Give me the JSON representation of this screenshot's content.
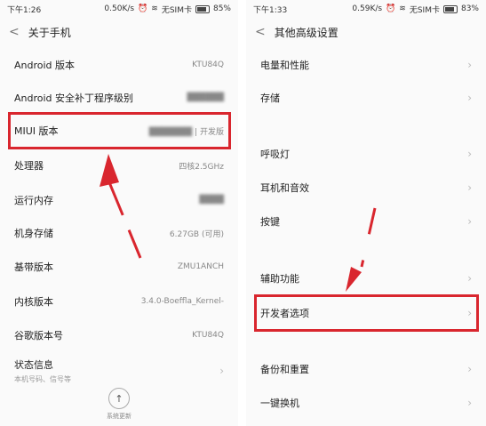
{
  "left": {
    "status": {
      "time": "下午1:26",
      "speed": "0.50K/s",
      "sim": "无SIM卡",
      "battery": "85%",
      "battery_level": 0.85
    },
    "title": "关于手机",
    "rows": [
      {
        "label": "Android 版本",
        "value": "KTU84Q"
      },
      {
        "label": "Android 安全补丁程序级别",
        "value": ""
      },
      {
        "label": "MIUI 版本",
        "value": "| 开发版"
      },
      {
        "label": "处理器",
        "value": "四核2.5GHz"
      },
      {
        "label": "运行内存",
        "value": ""
      },
      {
        "label": "机身存储",
        "value": "6.27GB (可用)"
      },
      {
        "label": "基带版本",
        "value": "ZMU1ANCH"
      },
      {
        "label": "内核版本",
        "value": "3.4.0-Boeffla_Kernel-"
      },
      {
        "label": "谷歌版本号",
        "value": "KTU84Q"
      },
      {
        "label": "状态信息",
        "sub": "本机号码、信号等"
      }
    ],
    "update_label": "系统更新"
  },
  "right": {
    "status": {
      "time": "下午1:33",
      "speed": "0.59K/s",
      "sim": "无SIM卡",
      "battery": "83%",
      "battery_level": 0.83
    },
    "title": "其他高级设置",
    "rows": [
      {
        "label": "电量和性能"
      },
      {
        "label": "存储"
      },
      {
        "label": "呼吸灯"
      },
      {
        "label": "耳机和音效"
      },
      {
        "label": "按键"
      },
      {
        "label": "辅助功能"
      },
      {
        "label": "开发者选项"
      },
      {
        "label": "备份和重置"
      },
      {
        "label": "一键换机"
      }
    ]
  }
}
